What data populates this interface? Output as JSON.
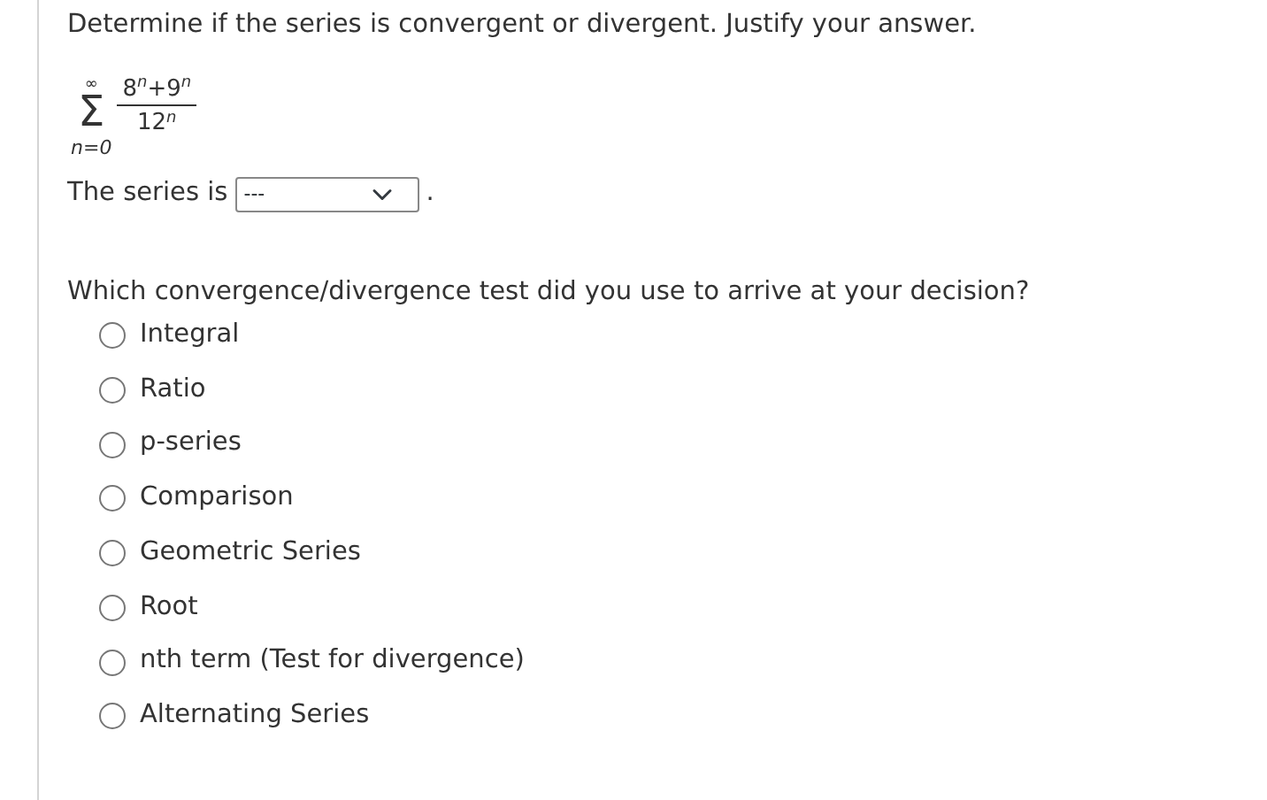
{
  "question": "Determine if the series is convergent or divergent. Justify your answer.",
  "series": {
    "upper": "∞",
    "symbol": "Σ",
    "lower": "n=0",
    "numerator": "8$^{n}$+9$^{n}$",
    "denominator": "12$^{n}$"
  },
  "answer": {
    "label": "The series is",
    "select_value": "---",
    "after": "."
  },
  "test_question": "Which convergence/divergence test did you use to arrive at your decision?",
  "options": [
    {
      "label": "Integral",
      "selected": false
    },
    {
      "label": "Ratio",
      "selected": false
    },
    {
      "label": "p-series",
      "selected": false
    },
    {
      "label": "Comparison",
      "selected": false
    },
    {
      "label": "Geometric Series",
      "selected": false
    },
    {
      "label": "Root",
      "selected": false
    },
    {
      "label": "nth term (Test for divergence)",
      "selected": false
    },
    {
      "label": "Alternating Series",
      "selected": false
    }
  ]
}
